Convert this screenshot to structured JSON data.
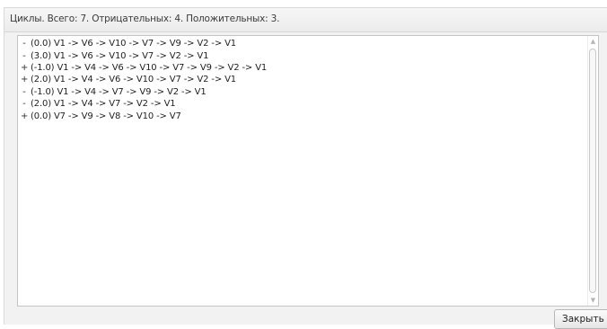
{
  "header": {
    "text": "Циклы. Всего: 7. Отрицательных: 4. Положительных: 3."
  },
  "cycles": [
    {
      "sign": "-",
      "path": "(0.0) V1 -> V6 -> V10 -> V7 -> V9 -> V2 -> V1"
    },
    {
      "sign": "-",
      "path": "(3.0) V1 -> V6 -> V10 -> V7 -> V2 -> V1"
    },
    {
      "sign": "+",
      "path": "(-1.0) V1 -> V4 -> V6 -> V10 -> V7 -> V9 -> V2 -> V1"
    },
    {
      "sign": "+",
      "path": "(2.0) V1 -> V4 -> V6 -> V10 -> V7 -> V2 -> V1"
    },
    {
      "sign": "-",
      "path": "(-1.0) V1 -> V4 -> V7 -> V9 -> V2 -> V1"
    },
    {
      "sign": "-",
      "path": "(2.0) V1 -> V4 -> V7 -> V2 -> V1"
    },
    {
      "sign": "+",
      "path": "(0.0) V7 -> V9 -> V8 -> V10 -> V7"
    }
  ],
  "scrollbar": {
    "up_icon": "chevron-up-icon",
    "down_icon": "chevron-down-icon"
  },
  "buttons": {
    "close_label": "Закрыть"
  }
}
